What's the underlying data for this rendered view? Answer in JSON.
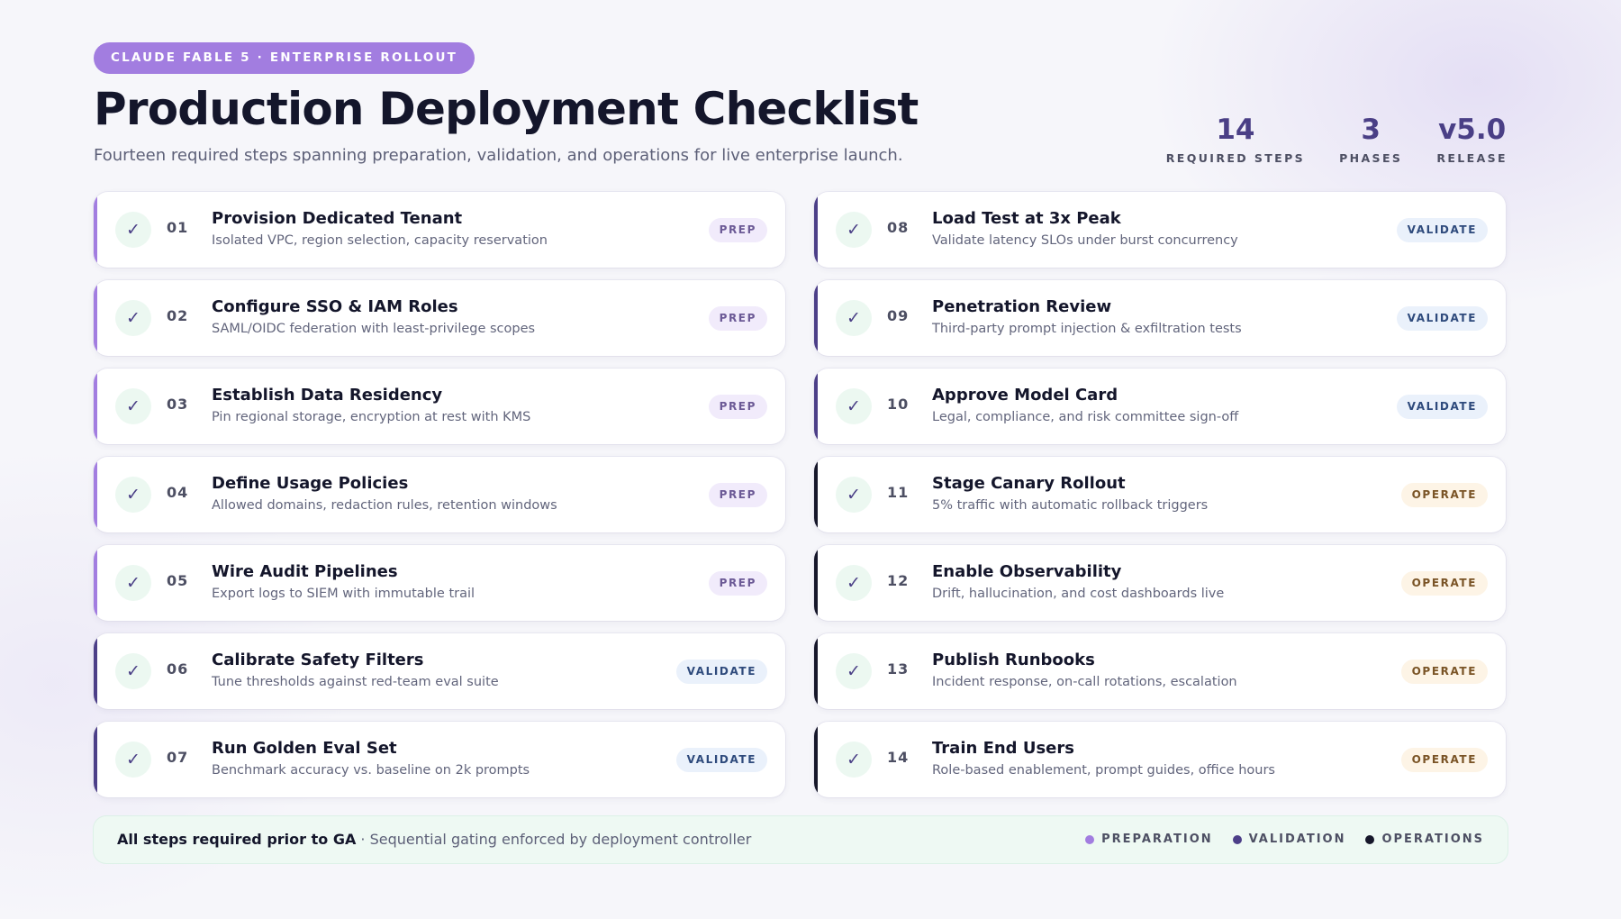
{
  "header": {
    "eyebrow": "CLAUDE FABLE 5 · ENTERPRISE ROLLOUT",
    "title": "Production Deployment Checklist",
    "subtitle": "Fourteen required steps spanning preparation, validation, and operations for live enterprise launch."
  },
  "stats": [
    {
      "value": "14",
      "label": "REQUIRED STEPS"
    },
    {
      "value": "3",
      "label": "PHASES"
    },
    {
      "value": "v5.0",
      "label": "RELEASE"
    }
  ],
  "check_glyph": "✓",
  "steps": [
    {
      "num": "01",
      "title": "Provision Dedicated Tenant",
      "desc": "Isolated VPC, region selection, capacity reservation",
      "phase": "prep",
      "badge": "PREP"
    },
    {
      "num": "02",
      "title": "Configure SSO & IAM Roles",
      "desc": "SAML/OIDC federation with least-privilege scopes",
      "phase": "prep",
      "badge": "PREP"
    },
    {
      "num": "03",
      "title": "Establish Data Residency",
      "desc": "Pin regional storage, encryption at rest with KMS",
      "phase": "prep",
      "badge": "PREP"
    },
    {
      "num": "04",
      "title": "Define Usage Policies",
      "desc": "Allowed domains, redaction rules, retention windows",
      "phase": "prep",
      "badge": "PREP"
    },
    {
      "num": "05",
      "title": "Wire Audit Pipelines",
      "desc": "Export logs to SIEM with immutable trail",
      "phase": "prep",
      "badge": "PREP"
    },
    {
      "num": "06",
      "title": "Calibrate Safety Filters",
      "desc": "Tune thresholds against red-team eval suite",
      "phase": "validate",
      "badge": "VALIDATE"
    },
    {
      "num": "07",
      "title": "Run Golden Eval Set",
      "desc": "Benchmark accuracy vs. baseline on 2k prompts",
      "phase": "validate",
      "badge": "VALIDATE"
    },
    {
      "num": "08",
      "title": "Load Test at 3x Peak",
      "desc": "Validate latency SLOs under burst concurrency",
      "phase": "validate",
      "badge": "VALIDATE"
    },
    {
      "num": "09",
      "title": "Penetration Review",
      "desc": "Third-party prompt injection & exfiltration tests",
      "phase": "validate",
      "badge": "VALIDATE"
    },
    {
      "num": "10",
      "title": "Approve Model Card",
      "desc": "Legal, compliance, and risk committee sign-off",
      "phase": "validate",
      "badge": "VALIDATE"
    },
    {
      "num": "11",
      "title": "Stage Canary Rollout",
      "desc": "5% traffic with automatic rollback triggers",
      "phase": "operate",
      "badge": "OPERATE"
    },
    {
      "num": "12",
      "title": "Enable Observability",
      "desc": "Drift, hallucination, and cost dashboards live",
      "phase": "operate",
      "badge": "OPERATE"
    },
    {
      "num": "13",
      "title": "Publish Runbooks",
      "desc": "Incident response, on-call rotations, escalation",
      "phase": "operate",
      "badge": "OPERATE"
    },
    {
      "num": "14",
      "title": "Train End Users",
      "desc": "Role-based enablement, prompt guides, office hours",
      "phase": "operate",
      "badge": "OPERATE"
    }
  ],
  "footer": {
    "strong": "All steps required prior to GA",
    "note": " · Sequential gating enforced by deployment controller",
    "legend": [
      {
        "label": "PREPARATION",
        "color": "#a27de0"
      },
      {
        "label": "VALIDATION",
        "color": "#4c3f88"
      },
      {
        "label": "OPERATIONS",
        "color": "#16172a"
      }
    ]
  }
}
